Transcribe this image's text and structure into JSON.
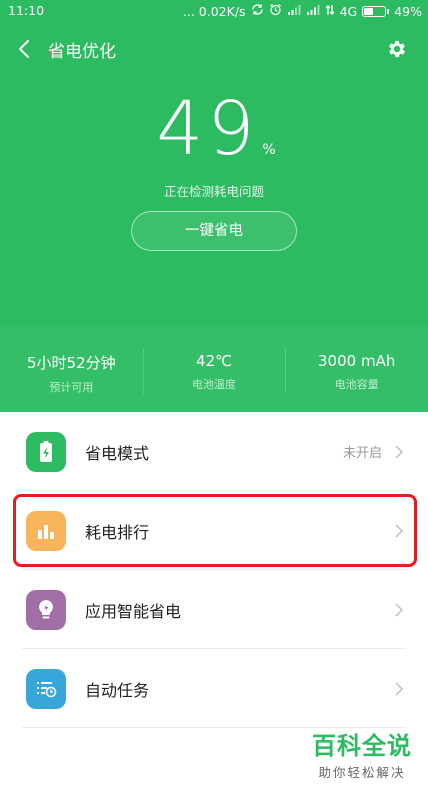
{
  "status_bar": {
    "time": "11:10",
    "network_speed": "... 0.02K/s",
    "network_type": "4G",
    "battery_percent": "49%",
    "battery_level": 0.49
  },
  "header": {
    "title": "省电优化",
    "back_icon": "chevron-left-icon",
    "settings_icon": "gear-icon",
    "bg_color": "#2dbb62"
  },
  "battery": {
    "percent_value": "49",
    "percent_unit": "%",
    "status_text": "正在检测耗电问题",
    "action_label": "一键省电"
  },
  "stats": [
    {
      "value": "5小时52分钟",
      "label": "预计可用"
    },
    {
      "value": "42℃",
      "label": "电池温度"
    },
    {
      "value": "3000 mAh",
      "label": "电池容量"
    }
  ],
  "menu": {
    "items": [
      {
        "label": "省电模式",
        "status": "未开启",
        "icon": "battery-charge-icon",
        "icon_color": "#2dbb62"
      },
      {
        "label": "耗电排行",
        "status": "",
        "icon": "bar-chart-icon",
        "icon_color": "#f7b45a"
      },
      {
        "label": "应用智能省电",
        "status": "",
        "icon": "lightbulb-icon",
        "icon_color": "#a26ea6"
      },
      {
        "label": "自动任务",
        "status": "",
        "icon": "scheduled-list-icon",
        "icon_color": "#36a7d8"
      }
    ]
  },
  "watermark": {
    "title": "百科全说",
    "subtitle": "助你轻松解决"
  }
}
